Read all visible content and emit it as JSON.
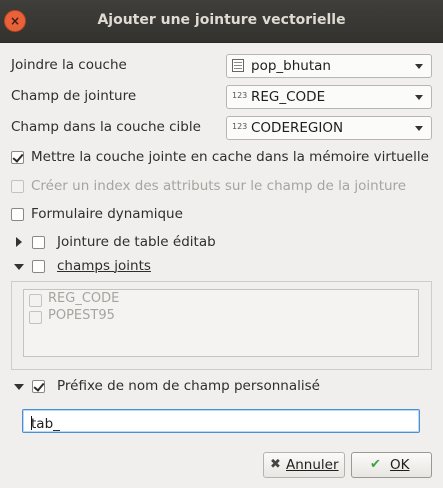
{
  "window": {
    "title": "Ajouter une jointure vectorielle",
    "close_symbol": "×"
  },
  "fields": {
    "join_layer": {
      "label": "Joindre la couche",
      "value": "pop_bhutan",
      "icon": "table-icon"
    },
    "join_field": {
      "label": "Champ de jointure",
      "value": "REG_CODE",
      "type_badge": "123"
    },
    "target_field": {
      "label": "Champ dans la couche cible",
      "value": "CODEREGION",
      "type_badge": "123"
    }
  },
  "options": {
    "cache": {
      "label": "Mettre la couche jointe en cache dans la mémoire virtuelle",
      "checked": true,
      "enabled": true
    },
    "index": {
      "label": "Créer un index des attributs sur le champ de la jointure",
      "checked": false,
      "enabled": false
    },
    "dynamic_form": {
      "label": "Formulaire dynamique",
      "checked": false,
      "enabled": true
    }
  },
  "groups": {
    "editable": {
      "label": "Jointure de table éditab",
      "expanded": false,
      "checked": false
    },
    "joined_fields": {
      "label": "champs joints",
      "expanded": true,
      "checked": false,
      "items": [
        {
          "label": "REG_CODE",
          "checked": false
        },
        {
          "label": "POPEST95",
          "checked": false
        }
      ]
    },
    "prefix": {
      "label": "Préfixe de nom de champ personnalisé",
      "expanded": true,
      "checked": true,
      "value": "tab_"
    }
  },
  "buttons": {
    "cancel": {
      "label": "Annuler",
      "icon": "✖"
    },
    "ok": {
      "label": "OK",
      "icon": "✔"
    }
  },
  "colors": {
    "ok_icon": "#3ea33e",
    "cancel_icon": "#444444",
    "focus_border": "#4a90d9",
    "close_button": "#e8613b"
  }
}
